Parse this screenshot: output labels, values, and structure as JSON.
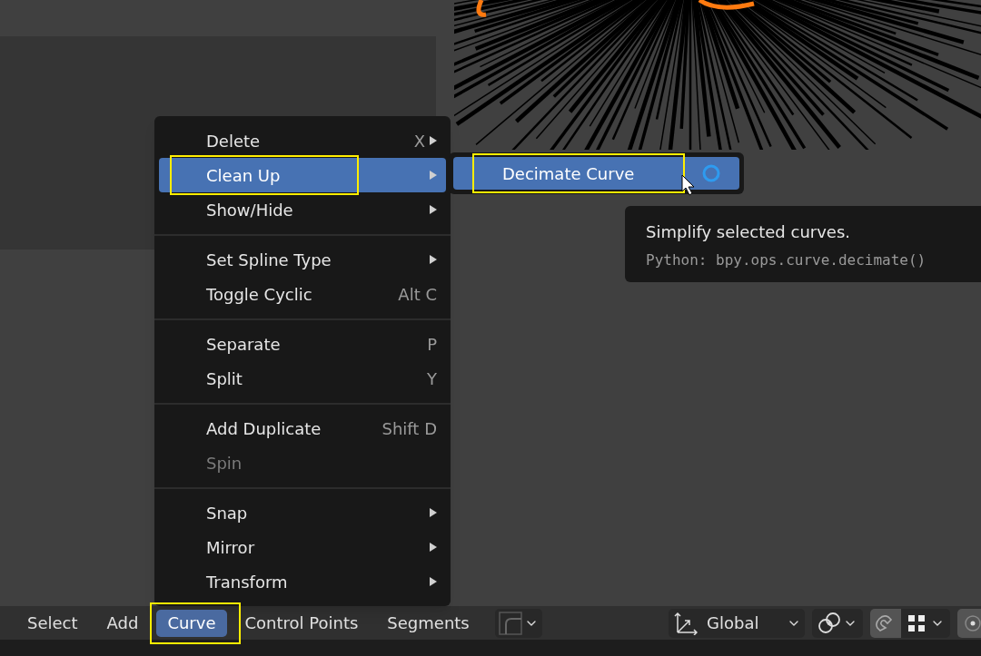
{
  "menu": {
    "groups": [
      [
        {
          "label": "Delete",
          "shortcut": "X",
          "submenu": true,
          "selected": false,
          "disabled": false,
          "highlighted": false
        },
        {
          "label": "Clean Up",
          "submenu": true,
          "selected": true,
          "disabled": false,
          "highlighted": true
        },
        {
          "label": "Show/Hide",
          "submenu": true,
          "selected": false,
          "disabled": false,
          "highlighted": false
        }
      ],
      [
        {
          "label": "Set Spline Type",
          "submenu": true,
          "selected": false,
          "disabled": false,
          "highlighted": false
        },
        {
          "label": "Toggle Cyclic",
          "shortcut": "Alt C",
          "submenu": false,
          "selected": false,
          "disabled": false,
          "highlighted": false
        }
      ],
      [
        {
          "label": "Separate",
          "shortcut": "P",
          "submenu": false,
          "selected": false,
          "disabled": false,
          "highlighted": false
        },
        {
          "label": "Split",
          "shortcut": "Y",
          "submenu": false,
          "selected": false,
          "disabled": false,
          "highlighted": false
        }
      ],
      [
        {
          "label": "Add Duplicate",
          "shortcut": "Shift D",
          "submenu": false,
          "selected": false,
          "disabled": false,
          "highlighted": false
        },
        {
          "label": "Spin",
          "submenu": false,
          "selected": false,
          "disabled": true,
          "highlighted": false
        }
      ],
      [
        {
          "label": "Snap",
          "submenu": true,
          "selected": false,
          "disabled": false,
          "highlighted": false
        },
        {
          "label": "Mirror",
          "submenu": true,
          "selected": false,
          "disabled": false,
          "highlighted": false
        },
        {
          "label": "Transform",
          "submenu": true,
          "selected": false,
          "disabled": false,
          "highlighted": false
        }
      ]
    ]
  },
  "submenu": {
    "items": [
      {
        "label": "Decimate Curve",
        "selected": true,
        "highlighted": true
      }
    ]
  },
  "tooltip": {
    "description": "Simplify selected curves.",
    "python": "Python: bpy.ops.curve.decimate()"
  },
  "header": {
    "menus": [
      {
        "label": "Select",
        "selected": false,
        "highlighted": false
      },
      {
        "label": "Add",
        "selected": false,
        "highlighted": false
      },
      {
        "label": "Curve",
        "selected": true,
        "highlighted": true
      },
      {
        "label": "Control Points",
        "selected": false,
        "highlighted": false
      },
      {
        "label": "Segments",
        "selected": false,
        "highlighted": false
      }
    ],
    "orientation": {
      "value": "Global"
    },
    "snap": {
      "on": true
    }
  }
}
